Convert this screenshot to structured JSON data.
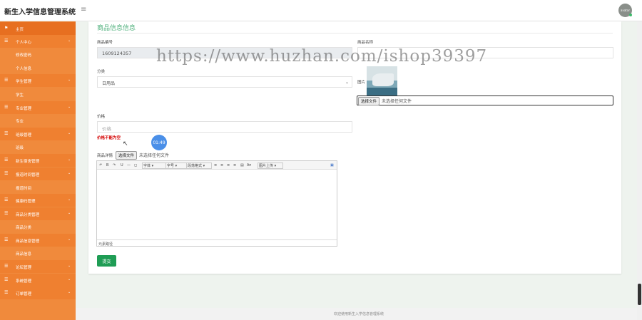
{
  "app": {
    "title": "新生入学信息管理系统",
    "menu_toggle": "≡",
    "avatar_text": "avatar"
  },
  "sidebar": {
    "items": [
      {
        "label": "主页",
        "icon": "flag-icon",
        "type": "group"
      },
      {
        "label": "个人中心",
        "icon": "menu-icon",
        "type": "group",
        "chevron": "⌄"
      },
      {
        "label": "修改密码",
        "type": "sub"
      },
      {
        "label": "个人信息",
        "type": "sub"
      },
      {
        "label": "学生管理",
        "icon": "menu-icon",
        "type": "group",
        "chevron": "⌄"
      },
      {
        "label": "学生",
        "type": "sub"
      },
      {
        "label": "专业管理",
        "icon": "menu-icon",
        "type": "group",
        "chevron": "⌄"
      },
      {
        "label": "专业",
        "type": "sub"
      },
      {
        "label": "班级管理",
        "icon": "menu-icon",
        "type": "group",
        "chevron": "⌄"
      },
      {
        "label": "班级",
        "type": "sub"
      },
      {
        "label": "新生宿舍管理",
        "icon": "menu-icon",
        "type": "group",
        "chevron": "⌄"
      },
      {
        "label": "报道时间管理",
        "icon": "menu-icon",
        "type": "group",
        "chevron": "⌄"
      },
      {
        "label": "报道时间",
        "type": "sub"
      },
      {
        "label": "健康码管理",
        "icon": "menu-icon",
        "type": "group",
        "chevron": "⌄"
      },
      {
        "label": "商品分类管理",
        "icon": "menu-icon",
        "type": "group",
        "chevron": "⌄"
      },
      {
        "label": "商品分类",
        "type": "sub"
      },
      {
        "label": "商品信息管理",
        "icon": "menu-icon",
        "type": "group",
        "chevron": "⌄"
      },
      {
        "label": "商品信息",
        "type": "sub"
      },
      {
        "label": "论坛管理",
        "icon": "menu-icon",
        "type": "group",
        "chevron": "⌄"
      },
      {
        "label": "系统管理",
        "icon": "menu-icon",
        "type": "group",
        "chevron": "⌄"
      },
      {
        "label": "订单管理",
        "icon": "menu-icon",
        "type": "group",
        "chevron": "⌄"
      }
    ]
  },
  "form": {
    "title": "商品信息信息",
    "code_label": "商品编号",
    "code_value": "1609124357",
    "name_label": "商品名称",
    "name_value": "",
    "category_label": "分类",
    "category_value": "日用品",
    "image_label": "图片",
    "file_button": "选择文件",
    "file_placeholder": "未选择任何文件",
    "price_label": "价格",
    "price_placeholder": "价格",
    "price_error": "价格不能为空",
    "detail_label": "商品详情",
    "detail_file_button": "选择文件",
    "detail_file_placeholder": "未选择任何文件",
    "submit_label": "提交"
  },
  "editor": {
    "font_family": "字体",
    "font_size": "字号",
    "paragraph": "段落格式",
    "insert": "图片上传",
    "status": "元素路径"
  },
  "timer": "01:49",
  "footer": "欢迎使用新生入学信息管理系统",
  "watermark": "https://www.huzhan.com/ishop39397"
}
